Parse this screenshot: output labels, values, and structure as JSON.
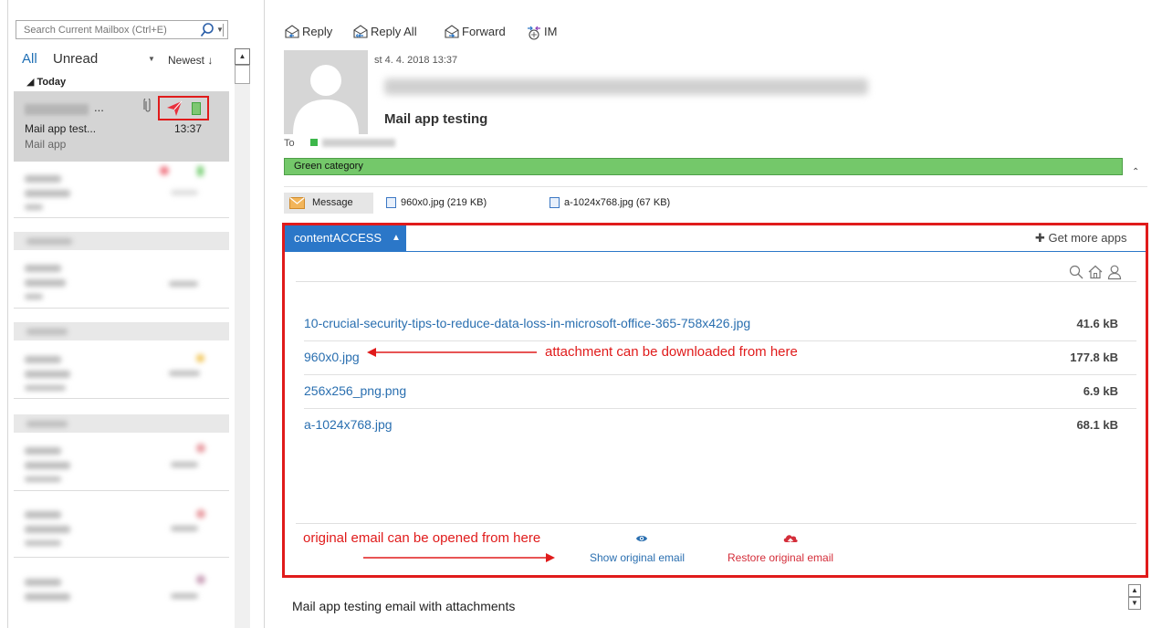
{
  "search": {
    "placeholder": "Search Current Mailbox (Ctrl+E)"
  },
  "filters": {
    "all": "All",
    "unread": "Unread",
    "sort": "Newest ↓"
  },
  "list": {
    "group_today": "Today",
    "selected_mail": {
      "sender_suffix": "...",
      "subject": "Mail app test...",
      "time": "13:37",
      "preview": "Mail app"
    }
  },
  "toolbar": {
    "reply": "Reply",
    "reply_all": "Reply All",
    "forward": "Forward",
    "im": "IM"
  },
  "message": {
    "date": "st 4. 4. 2018 13:37",
    "subject": "Mail app testing",
    "to_label": "To",
    "category": "Green category",
    "body": "Mail app testing email with attachments"
  },
  "attachments_bar": {
    "message_label": "Message",
    "files": [
      "960x0.jpg (219 KB)",
      "a-1024x768.jpg (67 KB)"
    ]
  },
  "addin": {
    "tab_label": "contentACCESS",
    "get_more": "Get more apps",
    "files": [
      {
        "name": "10-crucial-security-tips-to-reduce-data-loss-in-microsoft-office-365-758x426.jpg",
        "size": "41.6 kB"
      },
      {
        "name": "960x0.jpg",
        "size": "177.8 kB"
      },
      {
        "name": "256x256_png.png",
        "size": "6.9 kB"
      },
      {
        "name": "a-1024x768.jpg",
        "size": "68.1 kB"
      }
    ],
    "show_original": "Show original email",
    "restore_original": "Restore original email"
  },
  "annotations": {
    "attachment": "attachment can be downloaded from here",
    "original": "original email can be opened from here"
  },
  "colors": {
    "accent": "#2b77c8",
    "annotation_red": "#e01b1b",
    "category_green": "#74c86a",
    "link_blue": "#2a6fb0"
  }
}
